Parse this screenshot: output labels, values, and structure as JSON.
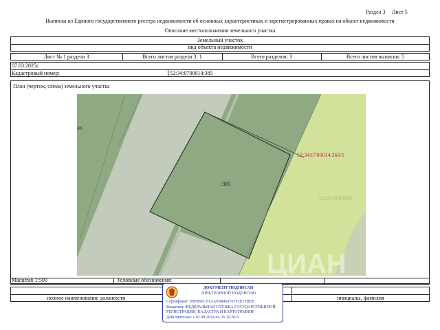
{
  "header": {
    "section_label": "Раздел 3",
    "sheet_label": "Лист 5",
    "title": "Выписка из Единого государственного реестра недвижимости об основных характеристиках и зарегистрированных правах на объект недвижимости",
    "subtitle": "Описание местоположения земельного участка"
  },
  "object": {
    "type": "Земельный участок",
    "type_caption": "вид объекта недвижимости"
  },
  "sheet_row": {
    "sheet_no": "Лист № 1 раздела 3",
    "total_sheets_section": "Всего листов раздела 3: 1",
    "total_sections": "Всего разделов: 3",
    "total_sheets_extract": "Всего листов выписки: 5"
  },
  "info": {
    "date": "07.03.2025г.",
    "cadastral_label": "Кадастровый номер:",
    "cadastral_value": "52:34:0700014:385"
  },
  "plan": {
    "title": "План (чертеж, схема) земельного участка",
    "label_left": "46",
    "label_parcel": ":385",
    "label_neighbor": "52:34:0700014:360/1",
    "label_faint": "52:00:0000000",
    "watermark": "ЦИАН"
  },
  "footer": {
    "scale": "Масштаб 1:500",
    "legend": "Условные обозначения:",
    "position_label": "полное наименование должности",
    "name_label": "инициалы, фамилия"
  },
  "stamp": {
    "line1": "ДОКУМЕНТ ПОДПИСАН",
    "line2": "ЭЛЕКТРОННОЙ ПОДПИСЬЮ",
    "cert": "Сертификат: 00F0BEC01AA0B8450767F2E1FBEE",
    "owner1": "Владелец: ФЕДЕРАЛЬНАЯ СЛУЖБА ГОСУДАРСТВЕННОЙ",
    "owner2": "РЕГИСТРАЦИИ, КАДАСТРА И КАРТОГРАФИИ",
    "valid": "Действителен: с 02.08.2024 по 26.10.2025"
  },
  "colors": {
    "parcel": "#8faa83",
    "road": "#c3cbbc",
    "neighbor": "#d2e29b",
    "stamp": "#2a3f9a",
    "neighbor_label": "#c0304a"
  }
}
